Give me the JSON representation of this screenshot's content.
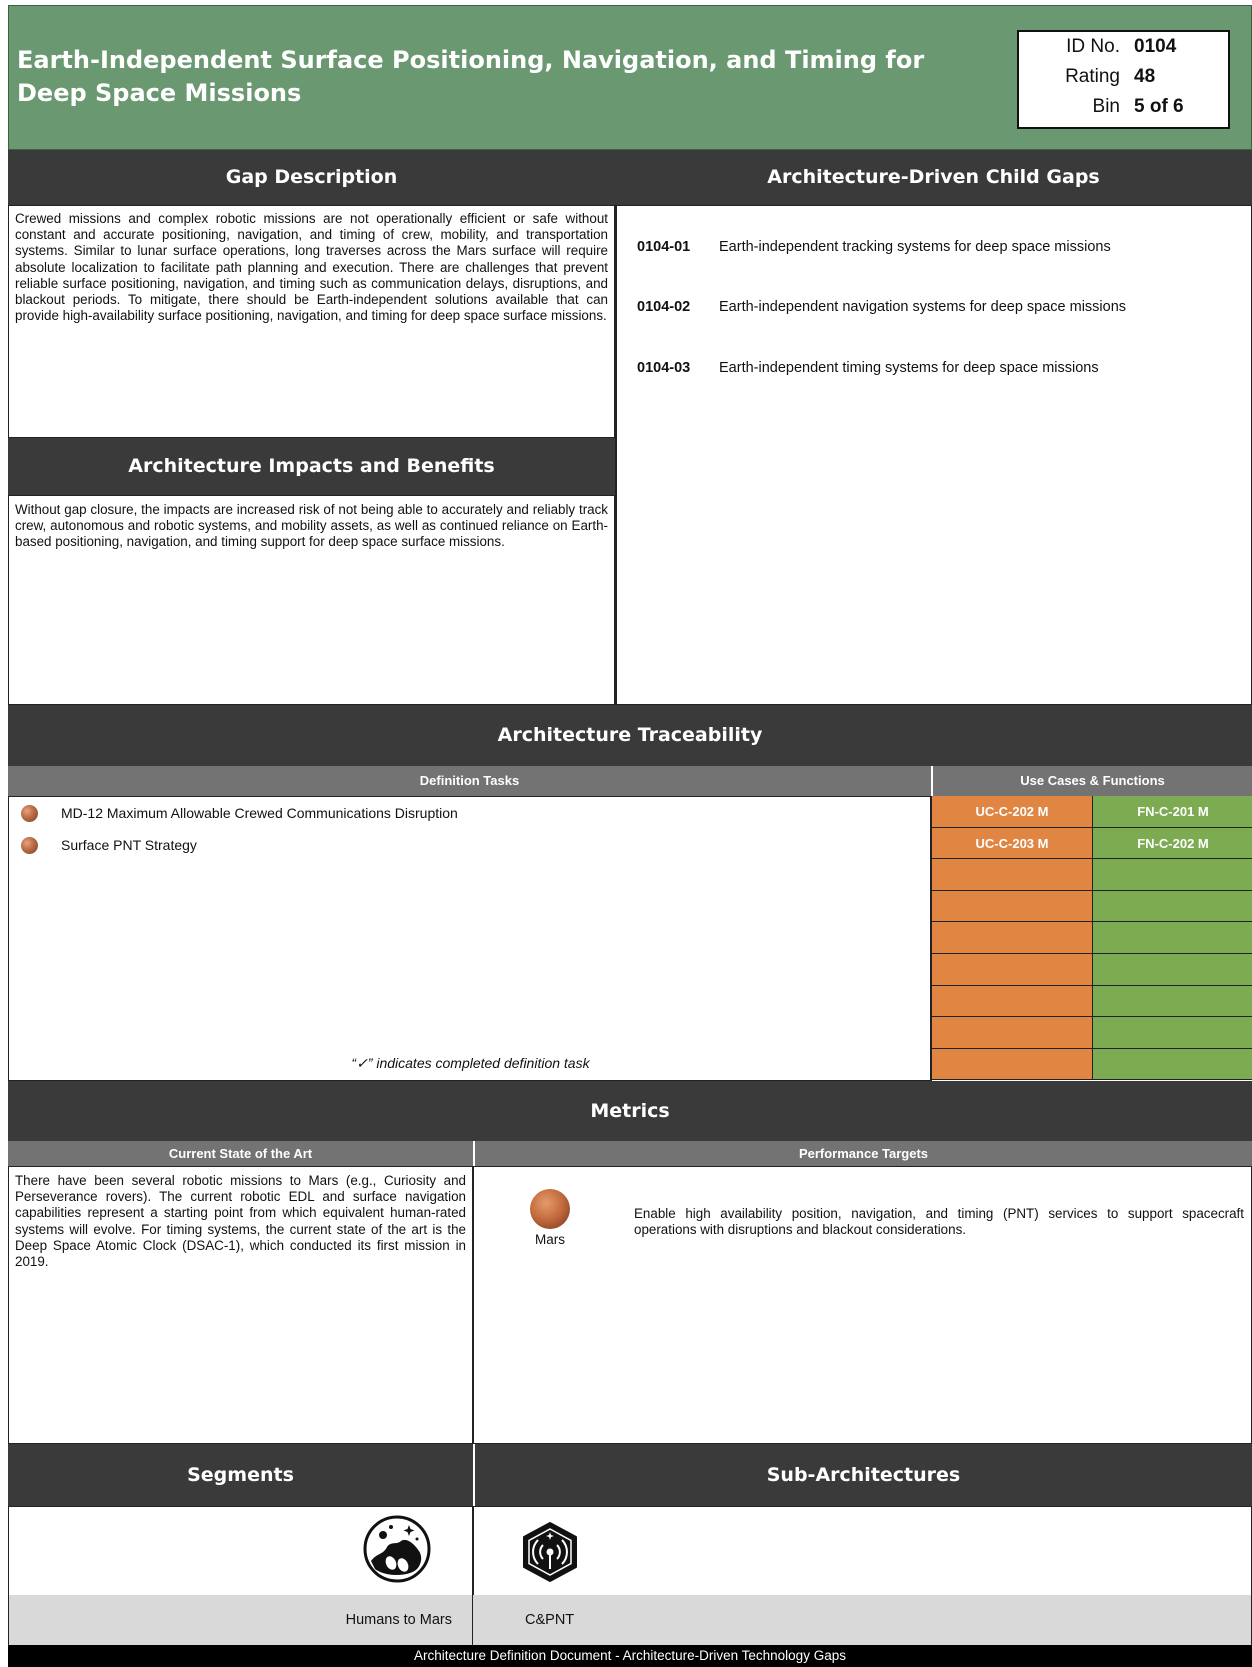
{
  "header": {
    "title": "Earth-Independent Surface Positioning, Navigation, and Timing for Deep Space Missions",
    "id_label": "ID No.",
    "id_value": "0104",
    "rating_label": "Rating",
    "rating_value": "48",
    "bin_label": "Bin",
    "bin_value": "5 of 6"
  },
  "gap_description": {
    "title": "Gap Description",
    "text": "Crewed missions and complex robotic missions are not operationally efficient or safe without constant and accurate positioning, navigation, and timing of crew, mobility, and transportation systems. Similar to lunar surface operations, long traverses across the Mars surface will require absolute localization to facilitate path planning and execution. There are challenges that prevent reliable surface positioning, navigation, and timing such as communication delays, disruptions, and blackout periods. To mitigate, there should be Earth-independent solutions available that can provide high-availability surface positioning, navigation, and timing for deep space surface missions."
  },
  "impacts": {
    "title": "Architecture Impacts and Benefits",
    "text": "Without gap closure, the impacts are increased risk of not being able to accurately and reliably track crew, autonomous and robotic systems, and mobility assets, as well as continued reliance on Earth-based positioning, navigation, and timing support for deep space surface missions."
  },
  "child_gaps": {
    "title": "Architecture-Driven Child Gaps",
    "items": [
      {
        "id": "0104-01",
        "text": "Earth-independent tracking systems for deep space missions"
      },
      {
        "id": "0104-02",
        "text": "Earth-independent navigation systems for deep space missions"
      },
      {
        "id": "0104-03",
        "text": "Earth-independent timing systems for deep space missions"
      }
    ]
  },
  "traceability": {
    "title": "Architecture Traceability",
    "definition_tasks_header": "Definition Tasks",
    "use_cases_header": "Use Cases & Functions",
    "tasks": [
      {
        "label": "MD-12 Maximum Allowable Crewed Communications Disruption"
      },
      {
        "label": "Surface PNT Strategy"
      }
    ],
    "note": "“✓” indicates completed definition task",
    "use_cases": [
      "UC-C-202 M",
      "UC-C-203 M",
      "",
      "",
      "",
      "",
      "",
      "",
      ""
    ],
    "functions": [
      "FN-C-201 M",
      "FN-C-202 M",
      "",
      "",
      "",
      "",
      "",
      "",
      ""
    ],
    "colors": {
      "use_case": "#e08542",
      "function": "#7dab52"
    }
  },
  "metrics": {
    "title": "Metrics",
    "soa_header": "Current State of the Art",
    "targets_header": "Performance Targets",
    "soa_text": "There have been several robotic missions to Mars (e.g., Curiosity and Perseverance rovers). The current robotic EDL and surface navigation capabilities represent a starting point from which equivalent human-rated systems will evolve. For timing systems, the current state of the art is the Deep Space Atomic Clock (DSAC-1), which conducted its first mission in 2019.",
    "target_destination": "Mars",
    "target_text": "Enable high availability position, navigation, and timing (PNT) services to support spacecraft operations with disruptions and blackout considerations."
  },
  "segments": {
    "title": "Segments",
    "icon": "humans-to-mars-icon",
    "label": "Humans to Mars"
  },
  "sub_architectures": {
    "title": "Sub-Architectures",
    "icon": "cpnt-icon",
    "label": "C&PNT"
  },
  "footer": {
    "text": "Architecture Definition Document - Architecture-Driven Technology Gaps"
  },
  "colors": {
    "header_bg": "#6a9870",
    "section_header_bg": "#3a3a3a",
    "sub_header_bg": "#737373"
  }
}
